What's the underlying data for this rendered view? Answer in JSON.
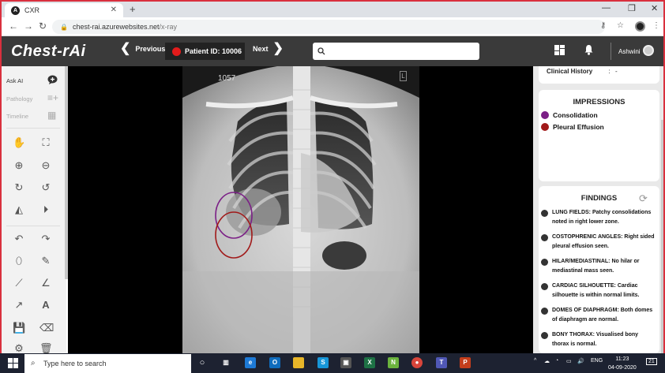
{
  "browser": {
    "tab_title": "CXR",
    "tab_icon": "A",
    "new_tab": "+",
    "url_host": "chest-rai.azurewebsites.net",
    "url_path": "/x-ray"
  },
  "header": {
    "logo": "Chest-rAi",
    "prev_label": "Previous",
    "patient_label": "Patient ID: 10006",
    "next_label": "Next",
    "search_placeholder": "",
    "username": "Ashwini"
  },
  "sidebar": {
    "ask_ai": "Ask AI",
    "pathology": "Pathology",
    "timeline": "Timeline"
  },
  "viewer": {
    "image_number": "1057",
    "marker": "L"
  },
  "clinical_history": {
    "label": "Clinical History",
    "separator": ":",
    "value": "-"
  },
  "impressions": {
    "title": "IMPRESSIONS",
    "items": [
      {
        "label": "Consolidation",
        "color": "#7b1f86"
      },
      {
        "label": "Pleural Effusion",
        "color": "#a11919"
      }
    ]
  },
  "findings": {
    "title": "FINDINGS",
    "items": [
      "LUNG FIELDS: Patchy consolidations noted in right lower zone.",
      "COSTOPHRENIC ANGLES: Right sided pleural effusion seen.",
      "HILAR/MEDIASTINAL: No hilar or mediastinal mass seen.",
      "CARDIAC SILHOUETTE: Cardiac silhouette is within normal limits.",
      "DOMES OF DIAPHRAGM: Both domes of diaphragm are normal.",
      "BONY THORAX: Visualised bony thorax is normal."
    ]
  },
  "taskbar": {
    "search_placeholder": "Type here to search",
    "language": "ENG",
    "time": "11:23",
    "date": "04-09-2020",
    "notification_count": "21"
  },
  "colors": {
    "header_bg": "#3a3a3a",
    "accent_red": "#e31b1b",
    "consolidation": "#7b1f86",
    "effusion": "#a11919"
  }
}
